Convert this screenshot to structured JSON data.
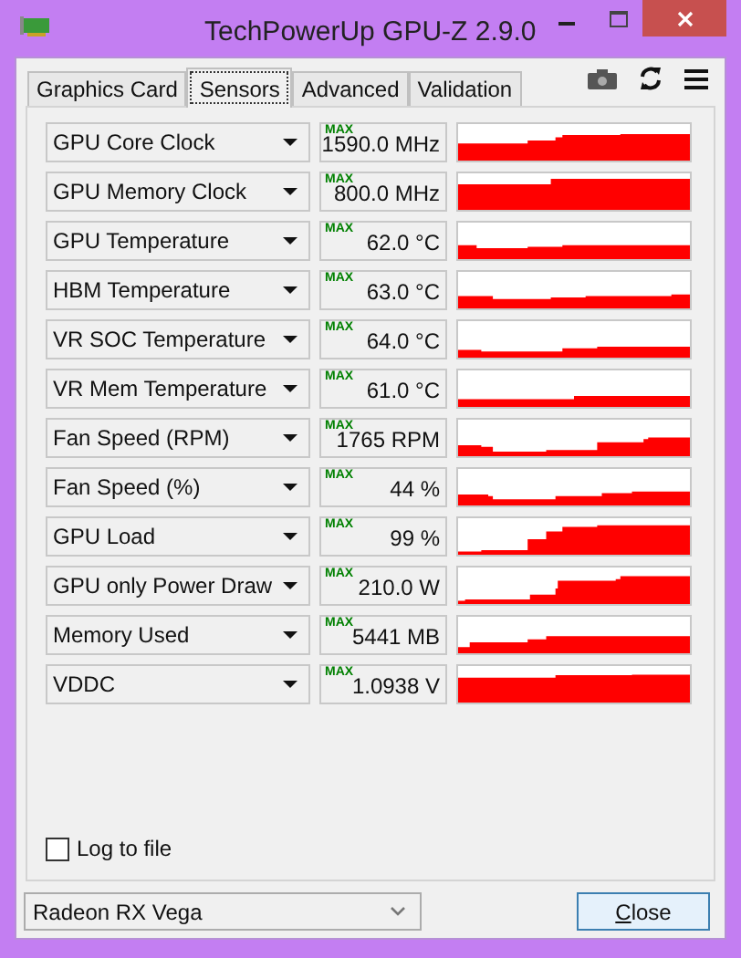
{
  "window": {
    "title": "TechPowerUp GPU-Z 2.9.0"
  },
  "tabs": [
    {
      "label": "Graphics Card",
      "selected": false
    },
    {
      "label": "Sensors",
      "selected": true
    },
    {
      "label": "Advanced",
      "selected": false
    },
    {
      "label": "Validation",
      "selected": false
    }
  ],
  "sensors": [
    {
      "name": "GPU Core Clock",
      "max_label": "MAX",
      "value": "1590.0 MHz"
    },
    {
      "name": "GPU Memory Clock",
      "max_label": "MAX",
      "value": "800.0 MHz"
    },
    {
      "name": "GPU Temperature",
      "max_label": "MAX",
      "value": "62.0 °C"
    },
    {
      "name": "HBM Temperature",
      "max_label": "MAX",
      "value": "63.0 °C"
    },
    {
      "name": "VR SOC Temperature",
      "max_label": "MAX",
      "value": "64.0 °C"
    },
    {
      "name": "VR Mem Temperature",
      "max_label": "MAX",
      "value": "61.0 °C"
    },
    {
      "name": "Fan Speed (RPM)",
      "max_label": "MAX",
      "value": "1765 RPM"
    },
    {
      "name": "Fan Speed (%)",
      "max_label": "MAX",
      "value": "44 %"
    },
    {
      "name": "GPU Load",
      "max_label": "MAX",
      "value": "99 %"
    },
    {
      "name": "GPU only Power Draw",
      "max_label": "MAX",
      "value": "210.0 W"
    },
    {
      "name": "Memory Used",
      "max_label": "MAX",
      "value": "5441 MB"
    },
    {
      "name": "VDDC",
      "max_label": "MAX",
      "value": "1.0938 V"
    }
  ],
  "log_to_file": {
    "label": "Log to file",
    "checked": false
  },
  "gpu_select": {
    "value": "Radeon RX Vega"
  },
  "close_button": {
    "label": "Close"
  }
}
